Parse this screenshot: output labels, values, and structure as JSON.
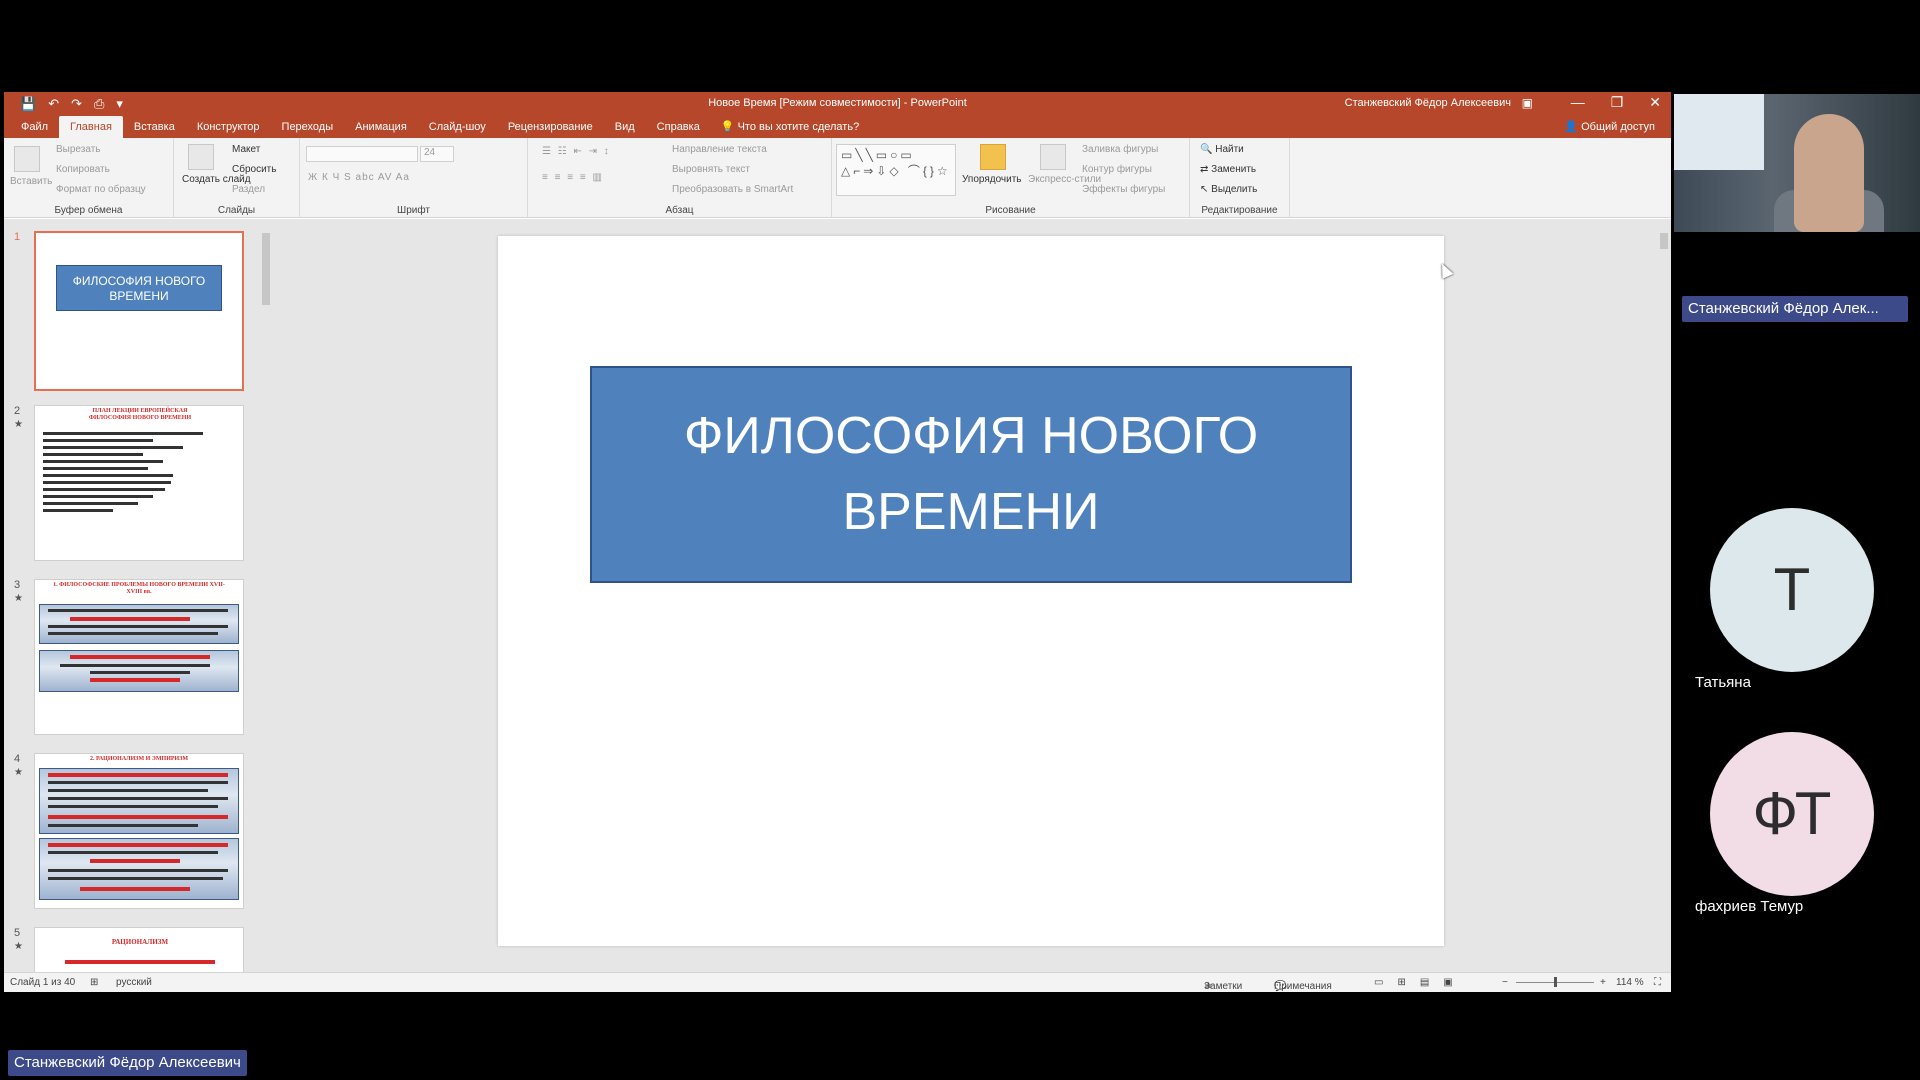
{
  "window": {
    "title": "Новое Время [Режим совместимости]  -  PowerPoint",
    "user": "Станжевский Фёдор Алексеевич",
    "controls": [
      "—",
      "❐",
      "✕"
    ]
  },
  "quick_access": [
    "💾",
    "↶",
    "↷",
    "⎙",
    "▾"
  ],
  "tabs": [
    {
      "label": "Файл"
    },
    {
      "label": "Главная",
      "active": true
    },
    {
      "label": "Вставка"
    },
    {
      "label": "Конструктор"
    },
    {
      "label": "Переходы"
    },
    {
      "label": "Анимация"
    },
    {
      "label": "Слайд-шоу"
    },
    {
      "label": "Рецензирование"
    },
    {
      "label": "Вид"
    },
    {
      "label": "Справка"
    }
  ],
  "tell_me": "Что вы хотите сделать?",
  "share": "Общий доступ",
  "ribbon": {
    "clipboard": {
      "label": "Буфер обмена",
      "paste": "Вставить",
      "cut": "Вырезать",
      "copy": "Копировать",
      "format_painter": "Формат по образцу"
    },
    "slides": {
      "label": "Слайды",
      "new_slide": "Создать слайд",
      "layout": "Макет",
      "reset": "Сбросить",
      "section": "Раздел"
    },
    "font": {
      "label": "Шрифт",
      "size": "24",
      "buttons": "Ж  К  Ч  S  abc  AV  Aa"
    },
    "paragraph": {
      "label": "Абзац",
      "text_direction": "Направление текста",
      "align_text": "Выровнять текст",
      "smartart": "Преобразовать в SmartArt"
    },
    "drawing": {
      "label": "Рисование",
      "arrange": "Упорядочить",
      "quick_styles": "Экспресс-стили",
      "fill": "Заливка фигуры",
      "outline": "Контур фигуры",
      "effects": "Эффекты фигуры",
      "shapes": "▭╲╲▭○▭ △⌐⇒⇩◇ ⌒{}☆"
    },
    "editing": {
      "label": "Редактирование",
      "find": "Найти",
      "replace": "Заменить",
      "select": "Выделить"
    }
  },
  "thumbnails": [
    {
      "num": "1",
      "title": "ФИЛОСОФИЯ НОВОГО ВРЕМЕНИ"
    },
    {
      "num": "2",
      "heading": "ПЛАН ЛЕКЦИИ ЕВРОПЕЙСКАЯ ФИЛОСОФИЯ НОВОГО ВРЕМЕНИ"
    },
    {
      "num": "3",
      "heading": "1. ФИЛОСОФСКИЕ ПРОБЛЕМЫ НОВОГО ВРЕМЕНИ XVII-XVIII вв."
    },
    {
      "num": "4",
      "heading": "2. РАЦИОНАЛИЗМ И ЭМПИРИЗМ"
    },
    {
      "num": "5",
      "heading": "РАЦИОНАЛИЗМ"
    }
  ],
  "slide": {
    "title": "ФИЛОСОФИЯ НОВОГО ВРЕМЕНИ"
  },
  "status": {
    "slide_counter": "Слайд 1 из 40",
    "language": "русский",
    "notes": "Заметки",
    "comments": "Примечания",
    "zoom": "114 %"
  },
  "conference": {
    "speaker_badge": "Станжевский Фёдор Алек...",
    "participants": [
      {
        "initials": "Т",
        "name": "Татьяна",
        "color": "#dce8ec"
      },
      {
        "initials": "ФТ",
        "name": "фахриев Темур",
        "color": "#f2dde6"
      }
    ],
    "bottom_name": "Станжевский Фёдор Алексеевич"
  }
}
